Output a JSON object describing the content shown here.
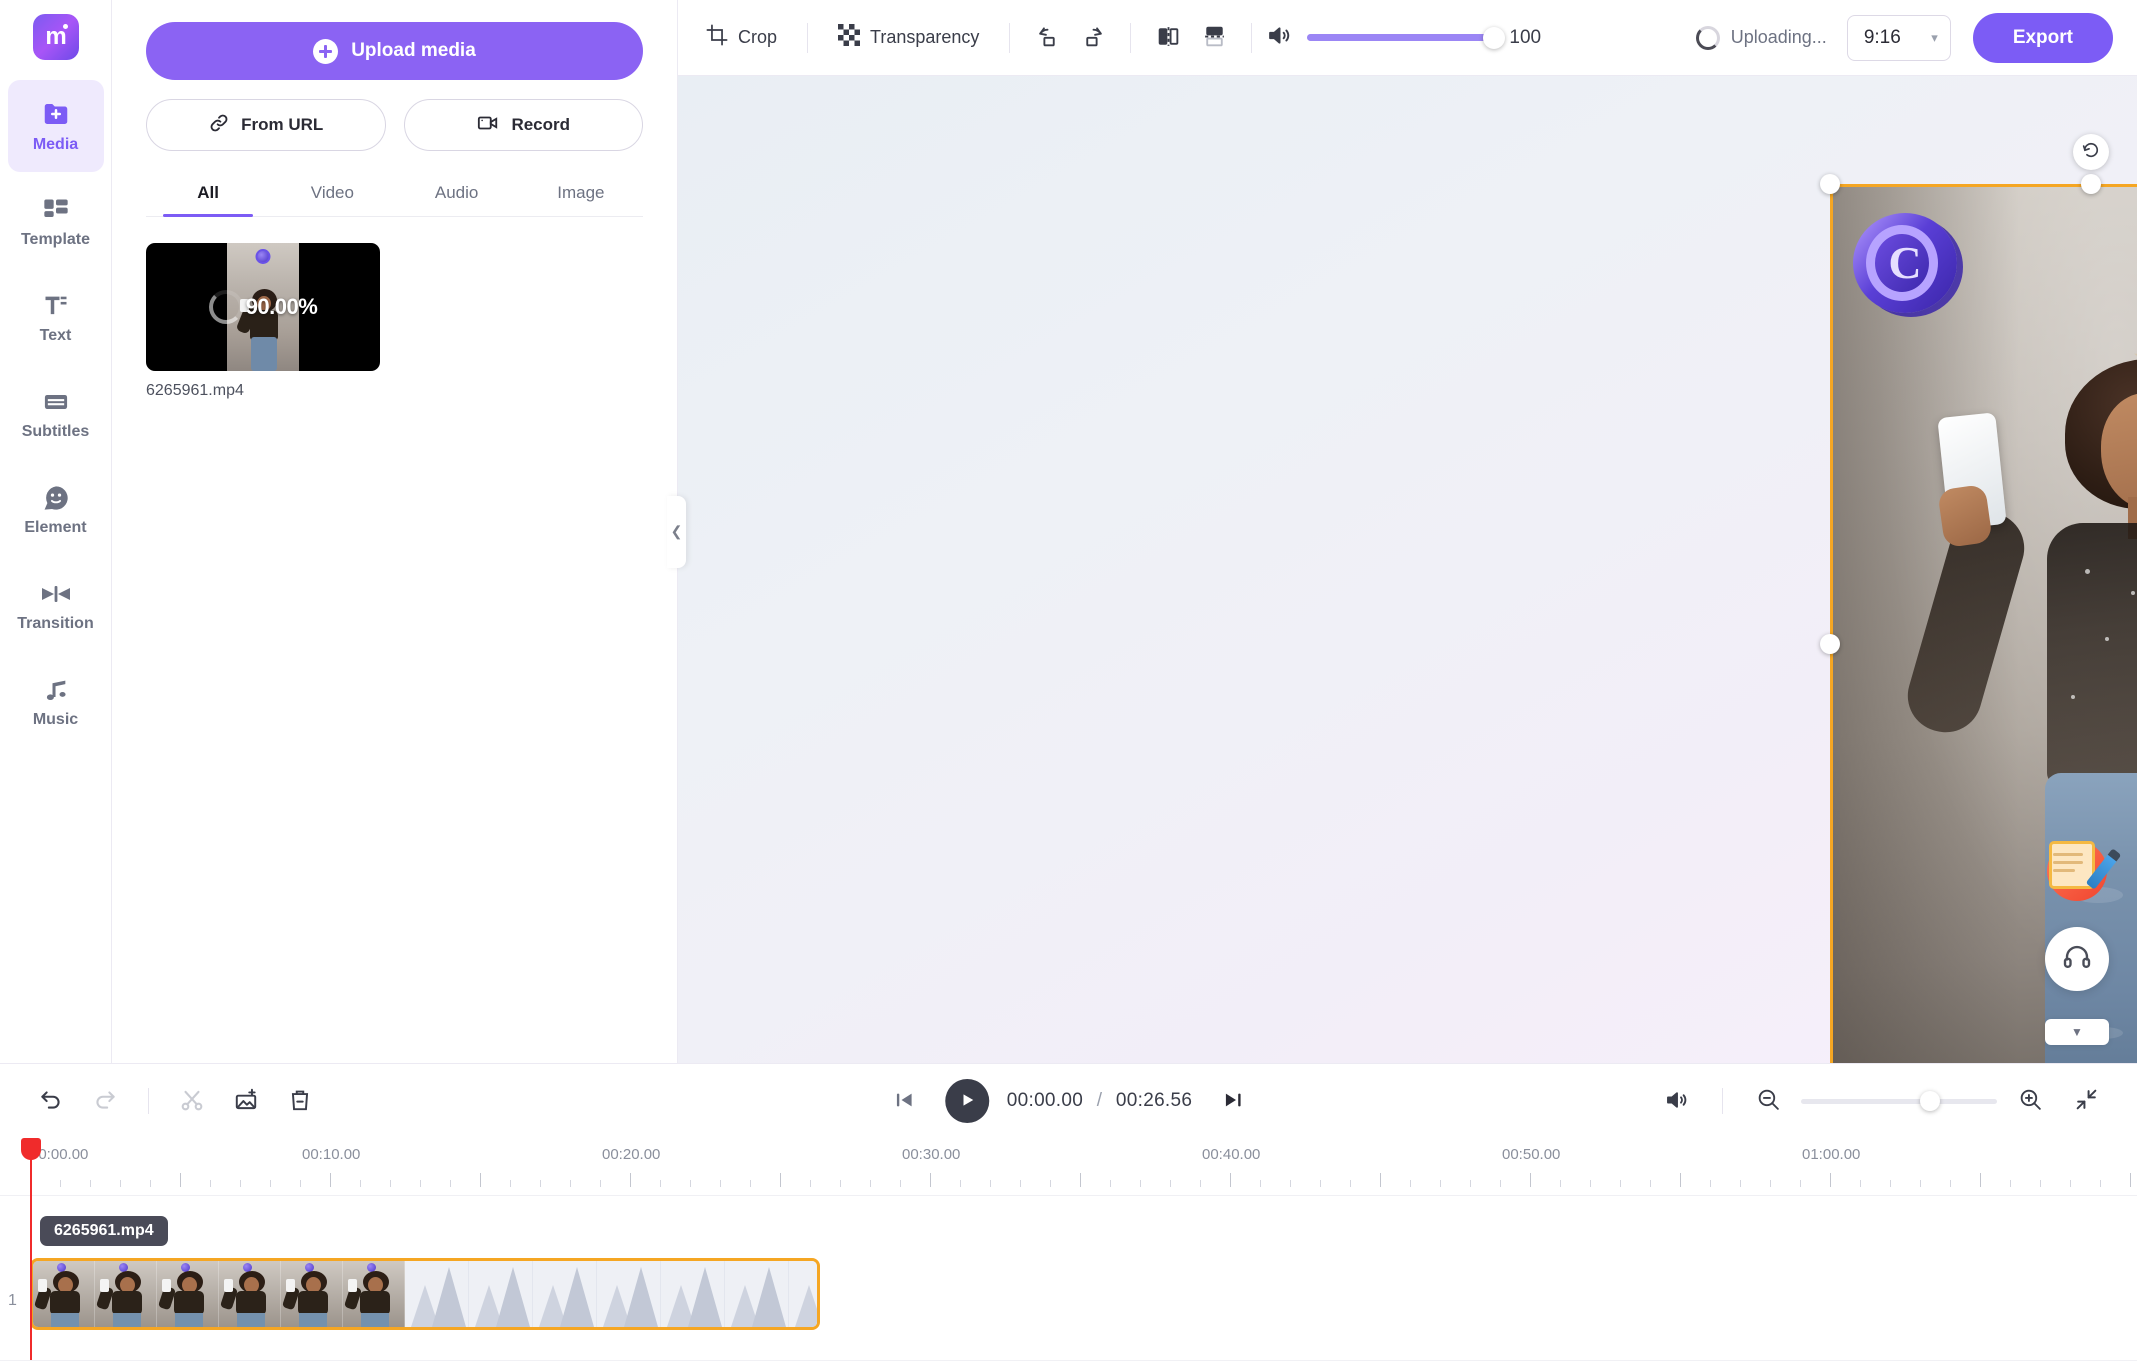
{
  "app": {
    "logo_letter": "m",
    "logo_name": "app-logo"
  },
  "sidebar": {
    "items": [
      {
        "label": "Media",
        "icon": "folder-plus-icon",
        "active": true
      },
      {
        "label": "Template",
        "icon": "template-grid-icon",
        "active": false
      },
      {
        "label": "Text",
        "icon": "text-icon",
        "active": false
      },
      {
        "label": "Subtitles",
        "icon": "subtitles-icon",
        "active": false
      },
      {
        "label": "Element",
        "icon": "element-sticker-icon",
        "active": false
      },
      {
        "label": "Transition",
        "icon": "transition-icon",
        "active": false
      },
      {
        "label": "Music",
        "icon": "music-note-icon",
        "active": false
      }
    ]
  },
  "panel": {
    "upload_label": "Upload media",
    "from_url_label": "From URL",
    "record_label": "Record",
    "tabs": [
      {
        "label": "All",
        "active": true
      },
      {
        "label": "Video",
        "active": false
      },
      {
        "label": "Audio",
        "active": false
      },
      {
        "label": "Image",
        "active": false
      }
    ],
    "media": [
      {
        "name": "6265961.mp4",
        "progress": "90.00%"
      }
    ],
    "collapse_icon": "chevron-left-icon"
  },
  "toolbar": {
    "crop_label": "Crop",
    "transparency_label": "Transparency",
    "rotate_left_icon": "rotate-left-icon",
    "rotate_right_icon": "rotate-right-icon",
    "flip_horizontal_icon": "flip-horizontal-icon",
    "flip_vertical_icon": "flip-vertical-icon",
    "volume_icon": "volume-icon",
    "volume_value": "100",
    "upload_status": "Uploading...",
    "aspect_ratio": "9:16",
    "export_label": "Export"
  },
  "preview": {
    "watermark_letter": "C",
    "rotate_handle_icon": "rotate-handle-icon",
    "feedback_icon": "feedback-notepad-icon",
    "support_icon": "headset-support-icon",
    "collapse_icon": "chevron-down-icon"
  },
  "timeline": {
    "undo_icon": "undo-icon",
    "redo_icon": "redo-icon",
    "split_icon": "split-scissors-icon",
    "add_media_icon": "add-image-icon",
    "delete_icon": "trash-icon",
    "prev_frame_icon": "skip-previous-icon",
    "play_icon": "play-icon",
    "next_frame_icon": "skip-next-icon",
    "current_time": "00:00.00",
    "time_separator": "/",
    "total_time": "00:26.56",
    "mute_icon": "volume-icon",
    "zoom_out_icon": "zoom-out-icon",
    "zoom_in_icon": "zoom-in-icon",
    "fit_icon": "fit-screen-icon",
    "ruler_labels": [
      "00:00.00",
      "00:10.00",
      "00:20.00",
      "00:30.00",
      "00:40.00",
      "00:50.00",
      "01:00.00"
    ],
    "track_number": "1",
    "clip_name": "6265961.mp4"
  },
  "colors": {
    "brand_purple": "#7c5cf5",
    "upload_purple": "#8b63f3",
    "selection_orange": "#f5a623",
    "playhead_red": "#f02b2b",
    "text_dark": "#2b2b35",
    "text_muted": "#6d7282"
  }
}
